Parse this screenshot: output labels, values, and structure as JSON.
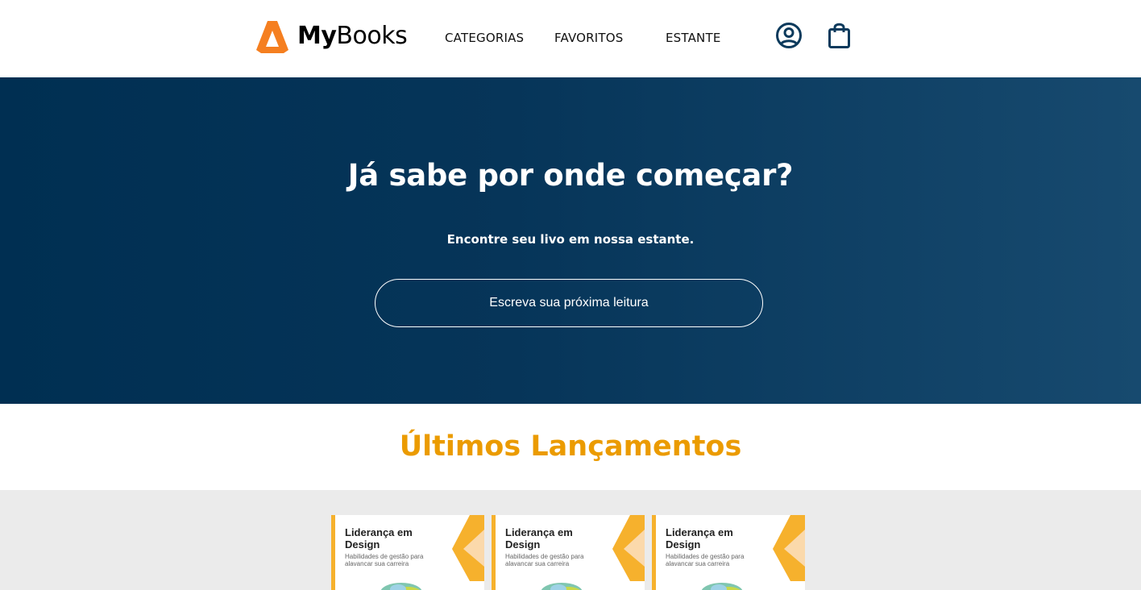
{
  "brand": {
    "name_bold": "My",
    "name_light": "Books",
    "accent": "#f57f20"
  },
  "nav": {
    "items": [
      {
        "label": "CATEGORIAS"
      },
      {
        "label": "FAVORITOS"
      },
      {
        "label": "ESTANTE"
      }
    ]
  },
  "header_icons": [
    "user-circle-icon",
    "shopping-bag-icon"
  ],
  "hero": {
    "title": "Já sabe por onde começar?",
    "subtitle": "Encontre seu livo em nossa estante.",
    "search_placeholder": "Escreva sua próxima leitura",
    "gradient": [
      "#002f52",
      "#174a6f"
    ]
  },
  "launches": {
    "title": "Últimos Lançamentos",
    "title_color": "#eb9b00",
    "books": [
      {
        "title": "Liderança em Design",
        "subtitle": "Habilidades de gestão para alavancar sua carreira"
      },
      {
        "title": "Liderança em Design",
        "subtitle": "Habilidades de gestão para alavancar sua carreira"
      },
      {
        "title": "Liderança em Design",
        "subtitle": "Habilidades de gestão para alavancar sua carreira"
      }
    ]
  }
}
